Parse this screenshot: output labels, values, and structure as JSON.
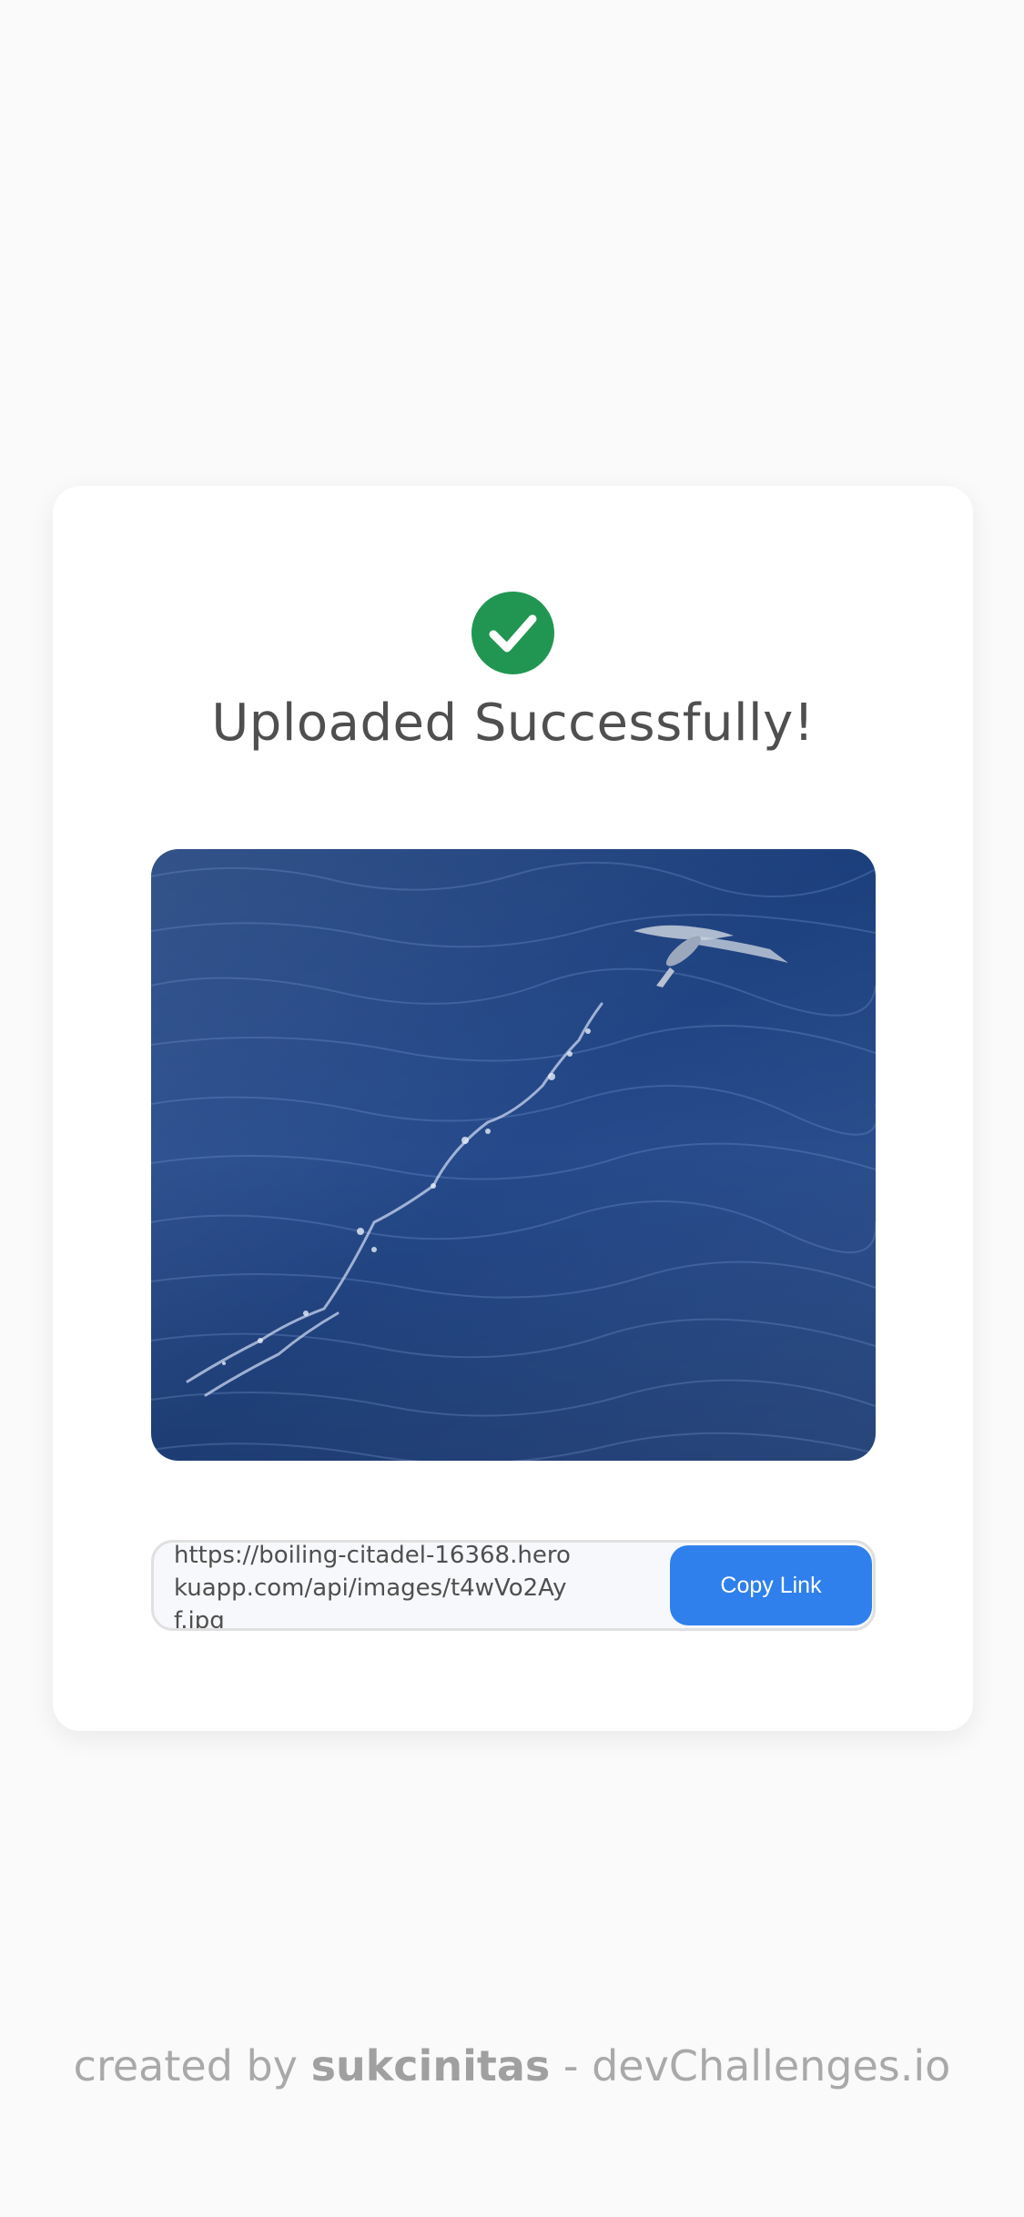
{
  "status": {
    "icon": "check-circle-icon",
    "title": "Uploaded Successfully!",
    "accent_color": "#219653"
  },
  "image": {
    "subject": "flying-fish-over-ocean"
  },
  "link": {
    "url": "https://boiling-citadel-16368.herokuapp.com/api/images/t4wVo2Ayf.jpg",
    "copy_label": "Copy Link",
    "button_color": "#2f80ed"
  },
  "footer": {
    "prefix": "created by",
    "author": "sukcinitas",
    "suffix": "- devChallenges.io"
  }
}
